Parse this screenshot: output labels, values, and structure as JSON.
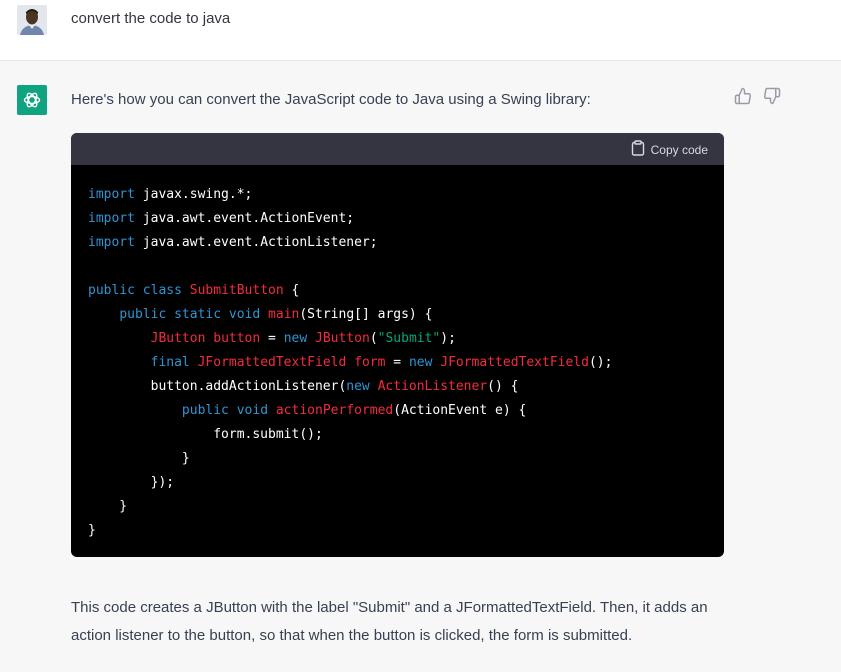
{
  "user_message": {
    "text": "convert the code to java"
  },
  "assistant_message": {
    "intro": "Here's how you can convert the JavaScript code to Java using a Swing library:",
    "code_block": {
      "copy_label": "Copy code",
      "lines": [
        [
          {
            "t": "import",
            "c": "kw"
          },
          {
            "t": " javax.swing.*;",
            "c": "pl"
          }
        ],
        [
          {
            "t": "import",
            "c": "kw"
          },
          {
            "t": " java.awt.event.ActionEvent;",
            "c": "pl"
          }
        ],
        [
          {
            "t": "import",
            "c": "kw"
          },
          {
            "t": " java.awt.event.ActionListener;",
            "c": "pl"
          }
        ],
        [],
        [
          {
            "t": "public",
            "c": "kw"
          },
          {
            "t": " ",
            "c": "pl"
          },
          {
            "t": "class",
            "c": "kw"
          },
          {
            "t": " ",
            "c": "pl"
          },
          {
            "t": "SubmitButton",
            "c": "cls"
          },
          {
            "t": " {",
            "c": "pl"
          }
        ],
        [
          {
            "t": "    ",
            "c": "pl"
          },
          {
            "t": "public",
            "c": "kw"
          },
          {
            "t": " ",
            "c": "pl"
          },
          {
            "t": "static",
            "c": "kw"
          },
          {
            "t": " ",
            "c": "pl"
          },
          {
            "t": "void",
            "c": "kw"
          },
          {
            "t": " ",
            "c": "pl"
          },
          {
            "t": "main",
            "c": "cls"
          },
          {
            "t": "(String[] args) {",
            "c": "pl"
          }
        ],
        [
          {
            "t": "        ",
            "c": "pl"
          },
          {
            "t": "JButton",
            "c": "cls"
          },
          {
            "t": " ",
            "c": "pl"
          },
          {
            "t": "button",
            "c": "cls"
          },
          {
            "t": " = ",
            "c": "pl"
          },
          {
            "t": "new",
            "c": "kw"
          },
          {
            "t": " ",
            "c": "pl"
          },
          {
            "t": "JButton",
            "c": "cls"
          },
          {
            "t": "(",
            "c": "pl"
          },
          {
            "t": "\"Submit\"",
            "c": "str"
          },
          {
            "t": ");",
            "c": "pl"
          }
        ],
        [
          {
            "t": "        ",
            "c": "pl"
          },
          {
            "t": "final",
            "c": "kw"
          },
          {
            "t": " ",
            "c": "pl"
          },
          {
            "t": "JFormattedTextField",
            "c": "cls"
          },
          {
            "t": " ",
            "c": "pl"
          },
          {
            "t": "form",
            "c": "cls"
          },
          {
            "t": " = ",
            "c": "pl"
          },
          {
            "t": "new",
            "c": "kw"
          },
          {
            "t": " ",
            "c": "pl"
          },
          {
            "t": "JFormattedTextField",
            "c": "cls"
          },
          {
            "t": "();",
            "c": "pl"
          }
        ],
        [
          {
            "t": "        button.addActionListener(",
            "c": "pl"
          },
          {
            "t": "new",
            "c": "kw"
          },
          {
            "t": " ",
            "c": "pl"
          },
          {
            "t": "ActionListener",
            "c": "cls"
          },
          {
            "t": "() {",
            "c": "pl"
          }
        ],
        [
          {
            "t": "            ",
            "c": "pl"
          },
          {
            "t": "public",
            "c": "kw"
          },
          {
            "t": " ",
            "c": "pl"
          },
          {
            "t": "void",
            "c": "kw"
          },
          {
            "t": " ",
            "c": "pl"
          },
          {
            "t": "actionPerformed",
            "c": "cls"
          },
          {
            "t": "(ActionEvent e) {",
            "c": "pl"
          }
        ],
        [
          {
            "t": "                form.submit();",
            "c": "pl"
          }
        ],
        [
          {
            "t": "            }",
            "c": "pl"
          }
        ],
        [
          {
            "t": "        });",
            "c": "pl"
          }
        ],
        [
          {
            "t": "    }",
            "c": "pl"
          }
        ],
        [
          {
            "t": "}",
            "c": "pl"
          }
        ]
      ]
    },
    "outro": "This code creates a JButton with the label \"Submit\" and a JFormattedTextField. Then, it adds an action listener to the button, so that when the button is clicked, the form is submitted."
  },
  "icons": {
    "avatar": "user-avatar",
    "assistant": "openai-logo-icon",
    "copy": "clipboard-icon",
    "thumbs_up": "thumbs-up-icon",
    "thumbs_down": "thumbs-down-icon"
  },
  "colors": {
    "assistant_bg": "#f7f7f8",
    "logo_bg": "#10a37f",
    "code_bg": "#000000",
    "code_header_bg": "#343541",
    "keyword": "#2e95d3",
    "class_name": "#f22c3d",
    "string": "#00a67d"
  }
}
